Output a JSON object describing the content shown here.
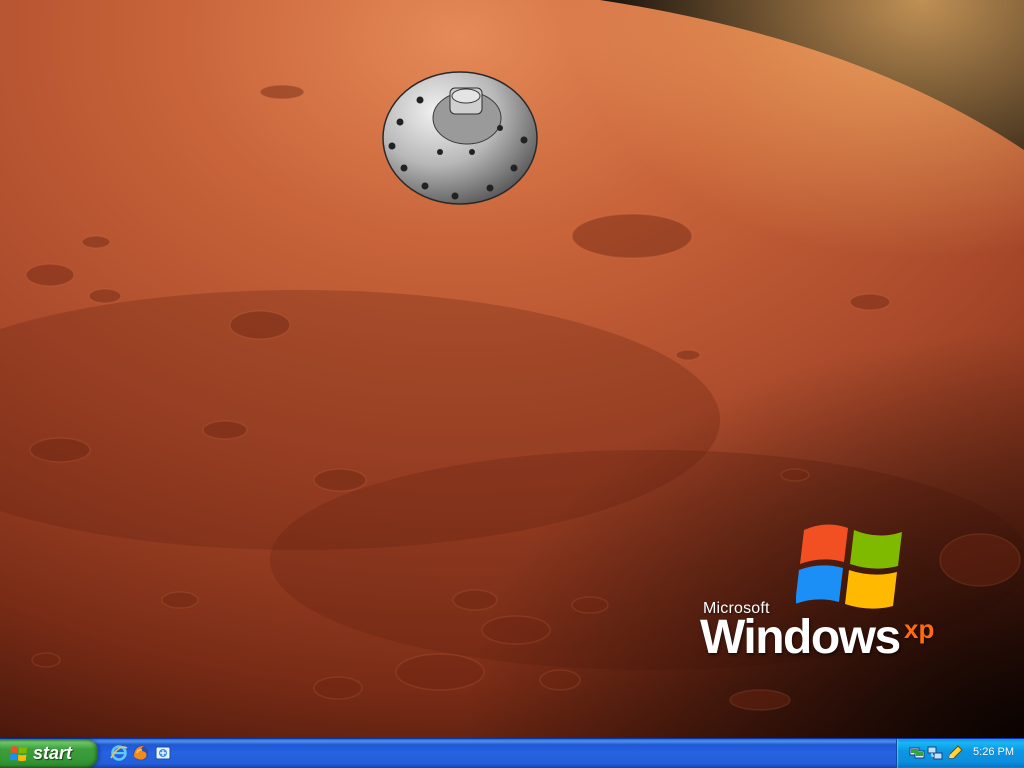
{
  "desktop": {
    "wallpaper": "mars-orbit-with-landing-capsule",
    "colors": {
      "mars_light": "#d96a40",
      "mars_mid": "#b64b26",
      "mars_dark": "#6b2310",
      "space": "#050505"
    }
  },
  "logo": {
    "brand_top": "Microsoft",
    "brand_main": "Windows",
    "brand_suffix": "xp",
    "colors": {
      "red": "#f25022",
      "green": "#7fba00",
      "blue": "#1b8ff5",
      "yellow": "#ffb900"
    }
  },
  "taskbar": {
    "start_label": "start",
    "quick_launch": [
      "internet-explorer-icon",
      "firefox-icon",
      "windows-explorer-icon"
    ],
    "tray_icons": [
      "network-connection-icon",
      "network-computers-icon",
      "update-pencil-icon"
    ],
    "clock": "5:26 PM",
    "colors": {
      "bar": "#245ed9",
      "start": "#3d9e3b",
      "tray": "#0d97e6"
    }
  }
}
